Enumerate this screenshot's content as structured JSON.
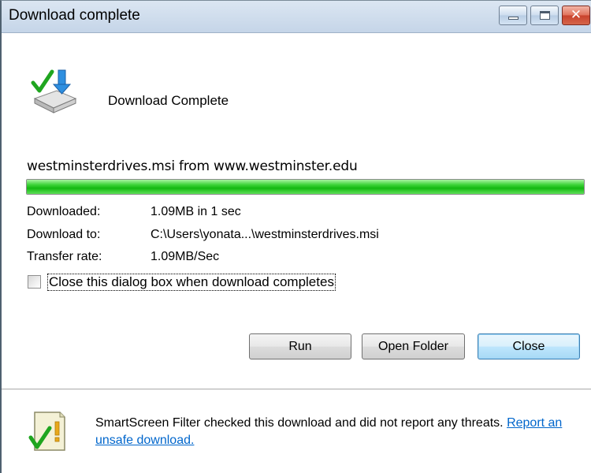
{
  "window": {
    "title": "Download complete"
  },
  "header": {
    "heading": "Download Complete",
    "icon": "download-complete-icon"
  },
  "download": {
    "source_line": "westminsterdrives.msi from www.westminster.edu",
    "progress_percent": 100,
    "rows": [
      {
        "label": "Downloaded:",
        "value": "1.09MB in 1 sec"
      },
      {
        "label": "Download to:",
        "value": "C:\\Users\\yonata...\\westminsterdrives.msi"
      },
      {
        "label": "Transfer rate:",
        "value": "1.09MB/Sec"
      }
    ]
  },
  "options": {
    "close_when_complete_label": "Close this dialog box when download completes",
    "close_when_complete_checked": false
  },
  "buttons": {
    "run_label": "Run",
    "open_folder_label": "Open Folder",
    "close_label": "Close"
  },
  "smartscreen": {
    "message": "SmartScreen Filter checked this download and did not report any threats.",
    "link_text": "Report an unsafe download.",
    "icon": "smartscreen-check-icon"
  },
  "colors": {
    "progress_green": "#14b811",
    "link_blue": "#0066cc",
    "default_button_border": "#3c7fb1"
  }
}
